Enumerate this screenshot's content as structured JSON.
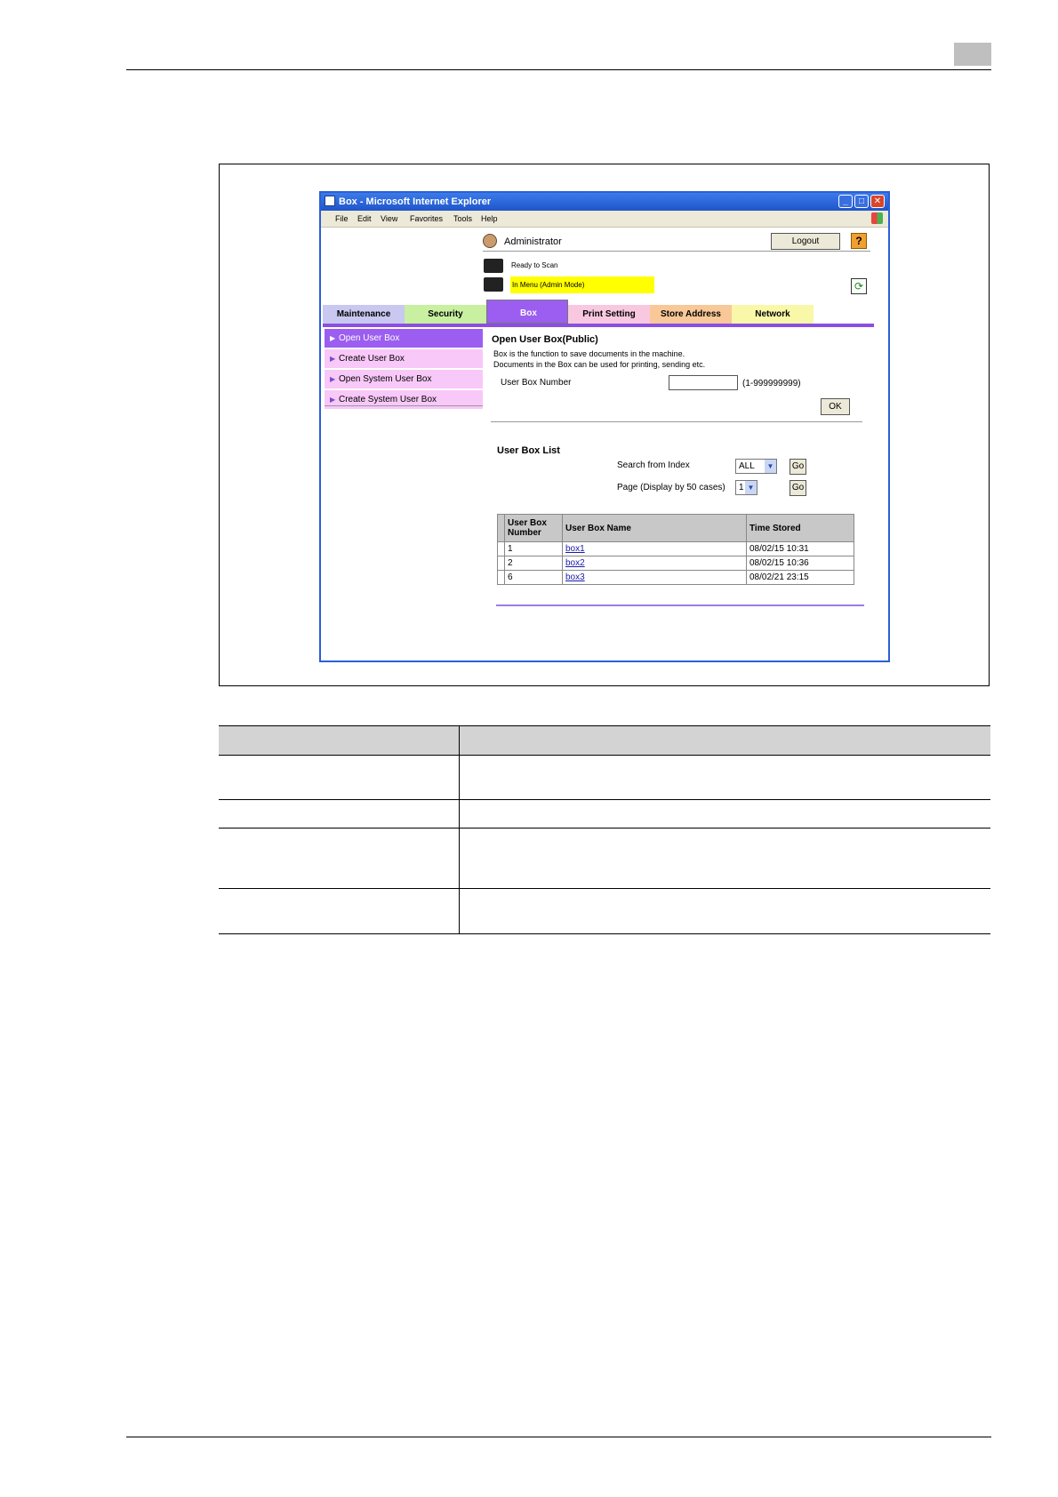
{
  "browser": {
    "window_title": "Box - Microsoft Internet Explorer",
    "menu": [
      "File",
      "Edit",
      "View",
      "Favorites",
      "Tools",
      "Help"
    ]
  },
  "header": {
    "user": "Administrator",
    "logout_label": "Logout",
    "help_label": "?",
    "status_ready": "Ready to Scan",
    "status_mode": "In Menu (Admin Mode)"
  },
  "tabs": [
    {
      "label": "Maintenance",
      "color": "#c8c8f0",
      "selected": false
    },
    {
      "label": "Security",
      "color": "#c8f0a0",
      "selected": false
    },
    {
      "label": "Box",
      "color": "#9b5ef0",
      "selected": true
    },
    {
      "label": "Print Setting",
      "color": "#f8c8e0",
      "selected": false
    },
    {
      "label": "Store Address",
      "color": "#f8c898",
      "selected": false
    },
    {
      "label": "Network",
      "color": "#f8f8a8",
      "selected": false
    }
  ],
  "sidebar": {
    "items": [
      {
        "label": "Open User Box",
        "selected": true
      },
      {
        "label": "Create User Box",
        "selected": false
      },
      {
        "label": "Open System User Box",
        "selected": false
      },
      {
        "label": "Create System User Box",
        "selected": false
      }
    ]
  },
  "main": {
    "title": "Open User Box(Public)",
    "desc_line1": "Box is the function to save documents in the machine.",
    "desc_line2": "Documents in the Box can be used for printing, sending etc.",
    "ubn_label": "User Box Number",
    "ubn_value": "",
    "ubn_range": "(1-999999999)",
    "ok_label": "OK"
  },
  "list": {
    "title": "User Box List",
    "search_label": "Search from Index",
    "search_value": "ALL",
    "page_label": "Page (Display by 50 cases)",
    "page_value": "1",
    "go_label": "Go",
    "columns": [
      "User Box Number",
      "User Box Name",
      "Time Stored"
    ],
    "col_number_line1": "User Box",
    "col_number_line2": "Number",
    "rows": [
      {
        "number": "1",
        "name": "box1",
        "time": "08/02/15 10:31"
      },
      {
        "number": "2",
        "name": "box2",
        "time": "08/02/15 10:36"
      },
      {
        "number": "6",
        "name": "box3",
        "time": "08/02/21 23:15"
      }
    ]
  },
  "colors": {
    "accent_purple": "#8a4fe0",
    "sidebar_selected": "#9b5ef0",
    "sidebar_item": "#f8c8f8",
    "status_highlight": "#ffff00",
    "titlebar_blue": "#2a5fd6"
  },
  "icons": [
    "admin-icon",
    "printer-icon",
    "refresh-icon",
    "help-icon",
    "windows-logo-icon"
  ]
}
